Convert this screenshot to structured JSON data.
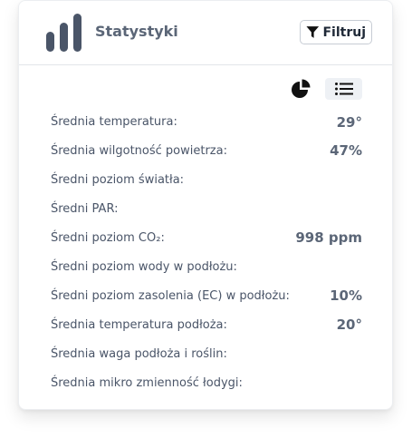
{
  "header": {
    "title": "Statystyki",
    "icon": "bar-chart-icon",
    "filter_label": "Filtruj",
    "filter_icon": "filter-icon"
  },
  "view_toggle": {
    "pie_icon": "pie-chart-icon",
    "list_icon": "list-icon",
    "active": "list"
  },
  "stats": [
    {
      "label": "Średnia temperatura:",
      "value": "29°"
    },
    {
      "label": "Średnia wilgotność powietrza:",
      "value": "47%"
    },
    {
      "label": "Średni poziom światła:",
      "value": ""
    },
    {
      "label": "Średni PAR:",
      "value": ""
    },
    {
      "label": "Średni poziom CO₂:",
      "value": "998 ppm"
    },
    {
      "label": "Średni poziom wody w podłożu:",
      "value": ""
    },
    {
      "label": "Średni poziom zasolenia (EC) w podłożu:",
      "value": "10%"
    },
    {
      "label": "Średnia temperatura podłoża:",
      "value": "20°"
    },
    {
      "label": "Średnia waga podłoża i roślin:",
      "value": ""
    },
    {
      "label": "Średnia mikro zmienność łodygi:",
      "value": ""
    }
  ],
  "colors": {
    "title": "#5b6677",
    "icon": "#4a5568",
    "accent_bg": "#eef1f5"
  }
}
